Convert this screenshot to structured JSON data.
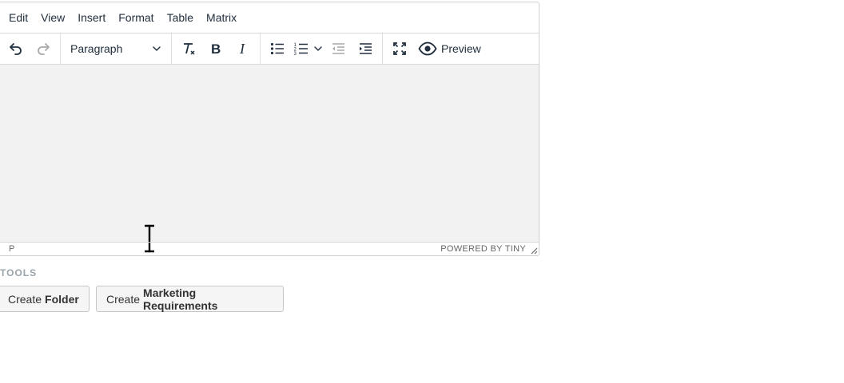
{
  "menubar": {
    "items": [
      "Edit",
      "View",
      "Insert",
      "Format",
      "Table",
      "Matrix"
    ]
  },
  "toolbar": {
    "block_format": "Paragraph",
    "preview_label": "Preview",
    "icons": [
      "undo-icon",
      "redo-icon",
      "clear-formatting-icon",
      "bold-icon",
      "italic-icon",
      "bullet-list-icon",
      "numbered-list-icon",
      "outdent-icon",
      "indent-icon",
      "fullscreen-icon",
      "eye-icon"
    ]
  },
  "statusbar": {
    "path": "P",
    "branding": "POWERED BY TINY"
  },
  "tools": {
    "heading": "TOOLS",
    "buttons": [
      {
        "prefix": "Create",
        "bold": "Folder"
      },
      {
        "prefix": "Create",
        "bold": "Marketing Requirements"
      }
    ]
  },
  "colors": {
    "content_bg": "#f2f2f2",
    "border": "#d0d0d0",
    "text": "#222f3e",
    "tools_heading": "#9aa4ab"
  }
}
